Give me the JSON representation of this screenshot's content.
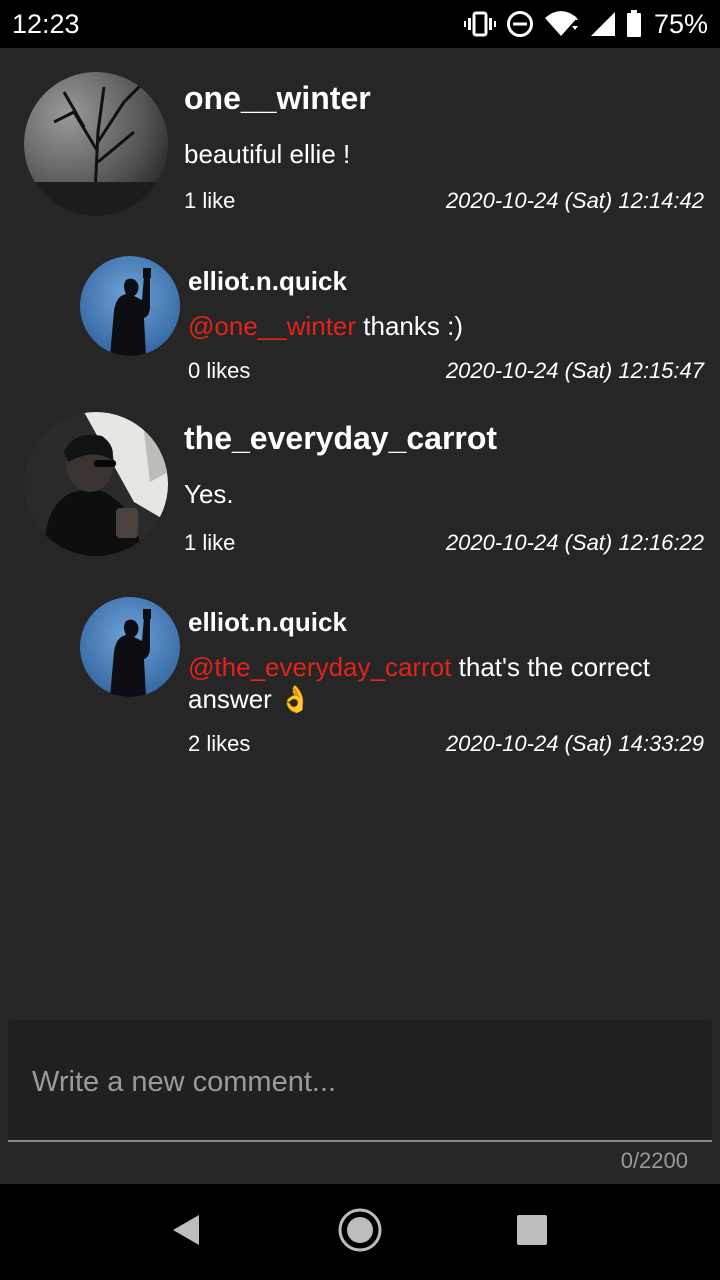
{
  "status_bar": {
    "time": "12:23",
    "battery": "75%",
    "icons": [
      "vibrate-icon",
      "do-not-disturb-icon",
      "wifi-icon",
      "cell-signal-icon",
      "battery-icon"
    ]
  },
  "comments": [
    {
      "username": "one__winter",
      "mention": "",
      "text": "beautiful ellie !",
      "likes": "1 like",
      "timestamp": "2020-10-24 (Sat) 12:14:42"
    },
    {
      "username": "elliot.n.quick",
      "mention": "@one__winter",
      "text": " thanks :)",
      "likes": "0 likes",
      "timestamp": "2020-10-24 (Sat) 12:15:47"
    },
    {
      "username": "the_everyday_carrot",
      "mention": "",
      "text": "Yes.",
      "likes": "1 like",
      "timestamp": "2020-10-24 (Sat) 12:16:22"
    },
    {
      "username": "elliot.n.quick",
      "mention": "@the_everyday_carrot",
      "text": " that's the correct answer 👌",
      "likes": "2 likes",
      "timestamp": "2020-10-24 (Sat) 14:33:29"
    }
  ],
  "comment_input": {
    "placeholder": "Write a new comment...",
    "value": "",
    "counter": "0/2200"
  },
  "nav": {
    "icons": [
      "back-icon",
      "home-icon",
      "recents-icon"
    ]
  },
  "colors": {
    "background": "#262626",
    "mention": "#e0241b",
    "bars": "#000000"
  }
}
